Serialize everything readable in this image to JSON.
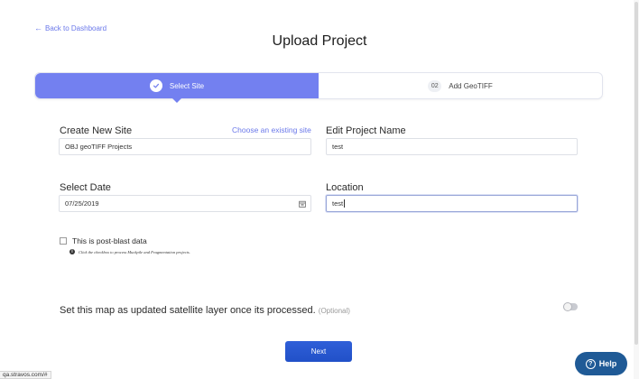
{
  "nav": {
    "back_label": "Back to Dashboard"
  },
  "header": {
    "title": "Upload Project"
  },
  "stepper": {
    "steps": [
      {
        "label": "Select Site",
        "state": "active"
      },
      {
        "number": "02",
        "label": "Add GeoTIFF",
        "state": "inactive"
      }
    ]
  },
  "form": {
    "create_site": {
      "label": "Create New Site",
      "link": "Choose an existing site",
      "value": "OBJ geoTIFF Projects"
    },
    "project_name": {
      "label": "Edit Project Name",
      "value": "test"
    },
    "date": {
      "label": "Select Date",
      "value": "07/25/2019"
    },
    "location": {
      "label": "Location",
      "value": "test"
    },
    "post_blast": {
      "label": "This is post-blast data",
      "checked": false,
      "hint": "Click the checkbox to process Muckpile and Fragmentation projects."
    },
    "satellite": {
      "label": "Set this map as updated satellite layer once its processed.",
      "optional": "(Optional)",
      "enabled": false
    }
  },
  "actions": {
    "next_label": "Next"
  },
  "status_bar": {
    "url": "qa.stravos.com/#"
  },
  "help": {
    "label": "Help"
  },
  "colors": {
    "accent": "#7380f0",
    "primary_button": "#2150c8",
    "help_button": "#1f5a96",
    "link": "#6a78ea"
  }
}
